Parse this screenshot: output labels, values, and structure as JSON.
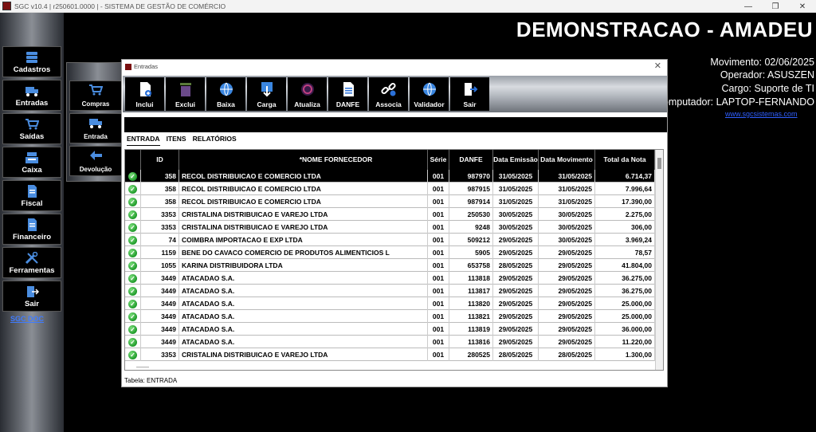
{
  "window": {
    "title": "SGC v10.4 | r250601.0000 | - SISTEMA DE GESTÃO DE COMÉRCIO",
    "minimize": "—",
    "maximize": "❐",
    "close": "✕"
  },
  "sidebar": {
    "items": [
      {
        "label": "Cadastros",
        "icon": "database-icon"
      },
      {
        "label": "Entradas",
        "icon": "truck-icon"
      },
      {
        "label": "Saídas",
        "icon": "cart-icon"
      },
      {
        "label": "Caixa",
        "icon": "register-icon"
      },
      {
        "label": "Fiscal",
        "icon": "document-icon"
      },
      {
        "label": "Financeiro",
        "icon": "document-icon"
      },
      {
        "label": "Ferramentas",
        "icon": "tools-icon"
      },
      {
        "label": "Sair",
        "icon": "exit-icon"
      }
    ],
    "doc_link": "SGC DOC"
  },
  "submenu": {
    "items": [
      {
        "label": "Compras",
        "icon": "cart-icon"
      },
      {
        "label": "Entrada",
        "icon": "truck-icon"
      },
      {
        "label": "Devolução",
        "icon": "return-arrow-icon"
      }
    ]
  },
  "header": {
    "company": "DEMONSTRACAO - AMADEU",
    "movimento": "Movimento: 02/06/2025",
    "operador": "Operador: ASUSZEN",
    "cargo": "Cargo: Suporte de TI",
    "computador": "Computador: LAPTOP-FERNANDO",
    "site": "www.sgcsistemas.com"
  },
  "dialog": {
    "title": "Entradas",
    "close": "✕",
    "toolbar": [
      {
        "label": "Inclui",
        "icon": "new-doc-icon"
      },
      {
        "label": "Exclui",
        "icon": "trash-icon"
      },
      {
        "label": "Baixa",
        "icon": "globe-icon"
      },
      {
        "label": "Carga",
        "icon": "download-icon"
      },
      {
        "label": "Atualiza",
        "icon": "refresh-icon"
      },
      {
        "label": "DANFE",
        "icon": "danfe-doc-icon"
      },
      {
        "label": "Associa",
        "icon": "link-icon"
      },
      {
        "label": "Validador",
        "icon": "globe-icon"
      },
      {
        "label": "Sair",
        "icon": "exit-icon"
      }
    ],
    "tabs": [
      {
        "label": "ENTRADA",
        "active": true
      },
      {
        "label": "ITENS",
        "active": false
      },
      {
        "label": "RELATÓRIOS",
        "active": false
      }
    ],
    "columns": [
      "",
      "ID",
      "*NOME FORNECEDOR",
      "Série",
      "DANFE",
      "Data Emissão",
      "Data Movimento",
      "Total da Nota"
    ],
    "rows": [
      {
        "id": "358",
        "fornecedor": "RECOL DISTRIBUICAO E COMERCIO LTDA",
        "serie": "001",
        "danfe": "987970",
        "emissao": "31/05/2025",
        "movimento": "31/05/2025",
        "total": "6.714,37",
        "selected": true
      },
      {
        "id": "358",
        "fornecedor": "RECOL DISTRIBUICAO E COMERCIO LTDA",
        "serie": "001",
        "danfe": "987915",
        "emissao": "31/05/2025",
        "movimento": "31/05/2025",
        "total": "7.996,64"
      },
      {
        "id": "358",
        "fornecedor": "RECOL DISTRIBUICAO E COMERCIO LTDA",
        "serie": "001",
        "danfe": "987914",
        "emissao": "31/05/2025",
        "movimento": "31/05/2025",
        "total": "17.390,00"
      },
      {
        "id": "3353",
        "fornecedor": "CRISTALINA DISTRIBUICAO E VAREJO LTDA",
        "serie": "001",
        "danfe": "250530",
        "emissao": "30/05/2025",
        "movimento": "30/05/2025",
        "total": "2.275,00"
      },
      {
        "id": "3353",
        "fornecedor": "CRISTALINA DISTRIBUICAO E VAREJO LTDA",
        "serie": "001",
        "danfe": "9248",
        "emissao": "30/05/2025",
        "movimento": "30/05/2025",
        "total": "306,00"
      },
      {
        "id": "74",
        "fornecedor": "COIMBRA IMPORTACAO E EXP LTDA",
        "serie": "001",
        "danfe": "509212",
        "emissao": "29/05/2025",
        "movimento": "30/05/2025",
        "total": "3.969,24"
      },
      {
        "id": "1159",
        "fornecedor": "BENE DO CAVACO COMERCIO DE PRODUTOS ALIMENTICIOS L",
        "serie": "001",
        "danfe": "5905",
        "emissao": "29/05/2025",
        "movimento": "29/05/2025",
        "total": "78,57"
      },
      {
        "id": "1055",
        "fornecedor": "KARINA DISTRIBUIDORA LTDA",
        "serie": "001",
        "danfe": "653758",
        "emissao": "28/05/2025",
        "movimento": "29/05/2025",
        "total": "41.804,00"
      },
      {
        "id": "3449",
        "fornecedor": "ATACADAO S.A.",
        "serie": "001",
        "danfe": "113818",
        "emissao": "29/05/2025",
        "movimento": "29/05/2025",
        "total": "36.275,00"
      },
      {
        "id": "3449",
        "fornecedor": "ATACADAO S.A.",
        "serie": "001",
        "danfe": "113817",
        "emissao": "29/05/2025",
        "movimento": "29/05/2025",
        "total": "36.275,00"
      },
      {
        "id": "3449",
        "fornecedor": "ATACADAO S.A.",
        "serie": "001",
        "danfe": "113820",
        "emissao": "29/05/2025",
        "movimento": "29/05/2025",
        "total": "25.000,00"
      },
      {
        "id": "3449",
        "fornecedor": "ATACADAO S.A.",
        "serie": "001",
        "danfe": "113821",
        "emissao": "29/05/2025",
        "movimento": "29/05/2025",
        "total": "25.000,00"
      },
      {
        "id": "3449",
        "fornecedor": "ATACADAO S.A.",
        "serie": "001",
        "danfe": "113819",
        "emissao": "29/05/2025",
        "movimento": "29/05/2025",
        "total": "36.000,00"
      },
      {
        "id": "3449",
        "fornecedor": "ATACADAO S.A.",
        "serie": "001",
        "danfe": "113816",
        "emissao": "29/05/2025",
        "movimento": "29/05/2025",
        "total": "11.220,00"
      },
      {
        "id": "3353",
        "fornecedor": "CRISTALINA DISTRIBUICAO E VAREJO LTDA",
        "serie": "001",
        "danfe": "280525",
        "emissao": "28/05/2025",
        "movimento": "28/05/2025",
        "total": "1.300,00"
      }
    ],
    "status": "Tabela: ENTRADA"
  },
  "colors": {
    "link_blue": "#3f7bff",
    "check_green": "#1f9a2a",
    "selection": "#000000"
  }
}
